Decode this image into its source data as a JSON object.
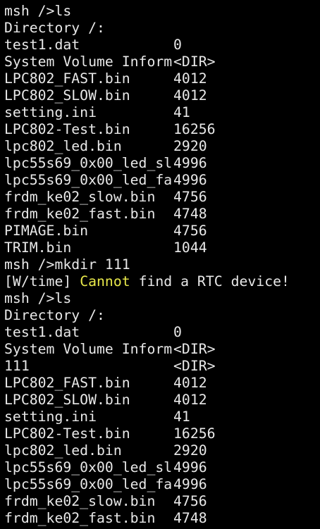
{
  "colors": {
    "background": "#000000",
    "text": "#e8e8e8",
    "warning": "#e8e84a"
  },
  "session": [
    {
      "kind": "cmd",
      "text": "msh />ls"
    },
    {
      "kind": "text",
      "text": "Directory /:"
    },
    {
      "kind": "entry",
      "name": "test1.dat",
      "size": "0"
    },
    {
      "kind": "entry",
      "name": "System Volume Inform",
      "size": "<DIR>"
    },
    {
      "kind": "entry",
      "name": "LPC802_FAST.bin",
      "size": "4012"
    },
    {
      "kind": "entry",
      "name": "LPC802_SLOW.bin",
      "size": "4012"
    },
    {
      "kind": "entry",
      "name": "setting.ini",
      "size": "41"
    },
    {
      "kind": "entry",
      "name": "LPC802-Test.bin",
      "size": "16256"
    },
    {
      "kind": "entry",
      "name": "lpc802_led.bin",
      "size": "2920"
    },
    {
      "kind": "entry",
      "name": "lpc55s69_0x00_led_sl",
      "size": "4996"
    },
    {
      "kind": "entry",
      "name": "lpc55s69_0x00_led_fa",
      "size": "4996"
    },
    {
      "kind": "entry",
      "name": "frdm_ke02_slow.bin",
      "size": "4756"
    },
    {
      "kind": "entry",
      "name": "frdm_ke02_fast.bin",
      "size": "4748"
    },
    {
      "kind": "entry",
      "name": "PIMAGE.bin",
      "size": "4756"
    },
    {
      "kind": "entry",
      "name": "TRIM.bin",
      "size": "1044"
    },
    {
      "kind": "cmd",
      "text": "msh />mkdir 111"
    },
    {
      "kind": "warning",
      "prefix": "[W/time] ",
      "highlight": "Cannot",
      "rest": " find a RTC device!"
    },
    {
      "kind": "cmd",
      "text": "msh />ls"
    },
    {
      "kind": "text",
      "text": "Directory /:"
    },
    {
      "kind": "entry",
      "name": "test1.dat",
      "size": "0"
    },
    {
      "kind": "entry",
      "name": "System Volume Inform",
      "size": "<DIR>"
    },
    {
      "kind": "entry",
      "name": "111",
      "size": "<DIR>"
    },
    {
      "kind": "entry",
      "name": "LPC802_FAST.bin",
      "size": "4012"
    },
    {
      "kind": "entry",
      "name": "LPC802_SLOW.bin",
      "size": "4012"
    },
    {
      "kind": "entry",
      "name": "setting.ini",
      "size": "41"
    },
    {
      "kind": "entry",
      "name": "LPC802-Test.bin",
      "size": "16256"
    },
    {
      "kind": "entry",
      "name": "lpc802_led.bin",
      "size": "2920"
    },
    {
      "kind": "entry",
      "name": "lpc55s69_0x00_led_sl",
      "size": "4996"
    },
    {
      "kind": "entry",
      "name": "lpc55s69_0x00_led_fa",
      "size": "4996"
    },
    {
      "kind": "entry",
      "name": "frdm_ke02_slow.bin",
      "size": "4756"
    },
    {
      "kind": "entry",
      "name": "frdm_ke02_fast.bin",
      "size": "4748"
    }
  ]
}
